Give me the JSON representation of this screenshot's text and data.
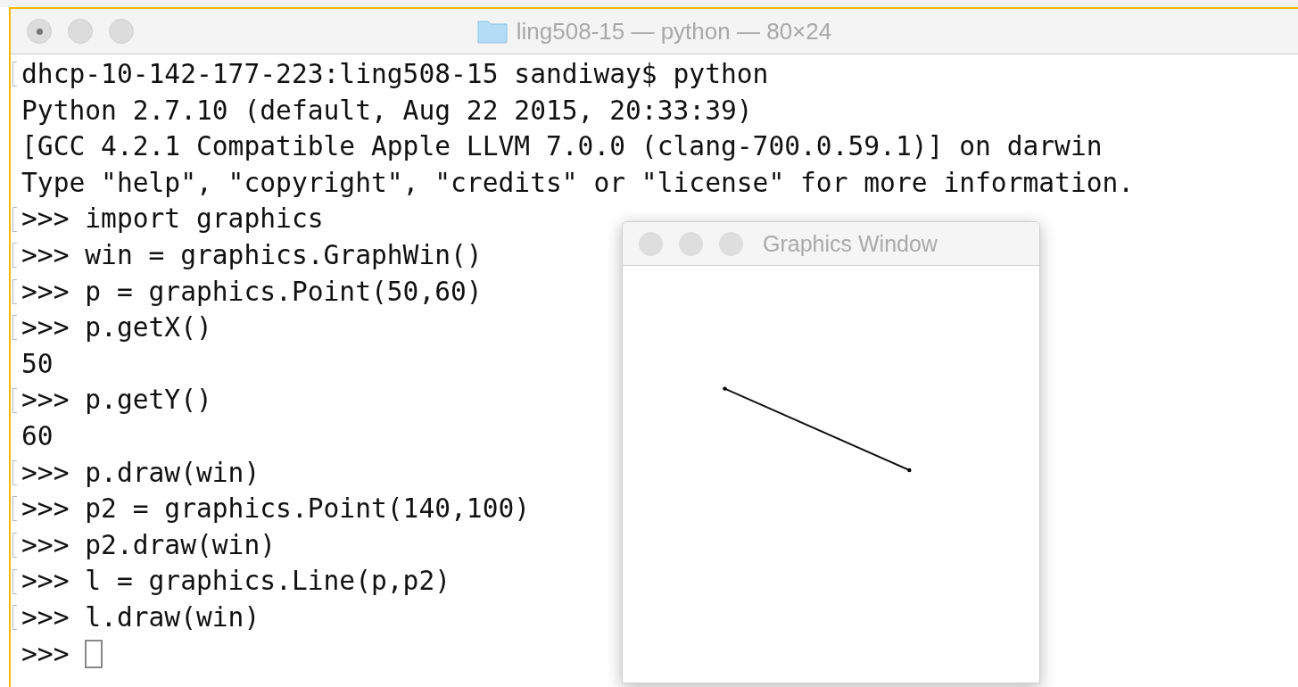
{
  "terminal": {
    "title": "ling508-15 — python — 80×24",
    "lines": [
      {
        "text": "dhcp-10-142-177-223:ling508-15 sandiway$ python",
        "marked": true
      },
      {
        "text": "Python 2.7.10 (default, Aug 22 2015, 20:33:39)",
        "marked": false
      },
      {
        "text": "[GCC 4.2.1 Compatible Apple LLVM 7.0.0 (clang-700.0.59.1)] on darwin",
        "marked": false
      },
      {
        "text": "Type \"help\", \"copyright\", \"credits\" or \"license\" for more information.",
        "marked": false
      },
      {
        "text": ">>> import graphics",
        "marked": true
      },
      {
        "text": ">>> win = graphics.GraphWin()",
        "marked": true
      },
      {
        "text": ">>> p = graphics.Point(50,60)",
        "marked": true
      },
      {
        "text": ">>> p.getX()",
        "marked": true
      },
      {
        "text": "50",
        "marked": false
      },
      {
        "text": ">>> p.getY()",
        "marked": true
      },
      {
        "text": "60",
        "marked": false
      },
      {
        "text": ">>> p.draw(win)",
        "marked": true
      },
      {
        "text": ">>> p2 = graphics.Point(140,100)",
        "marked": true
      },
      {
        "text": ">>> p2.draw(win)",
        "marked": true
      },
      {
        "text": ">>> l = graphics.Line(p,p2)",
        "marked": true
      },
      {
        "text": ">>> l.draw(win)",
        "marked": true
      }
    ],
    "prompt": ">>>"
  },
  "graphics_window": {
    "title": "Graphics Window"
  }
}
